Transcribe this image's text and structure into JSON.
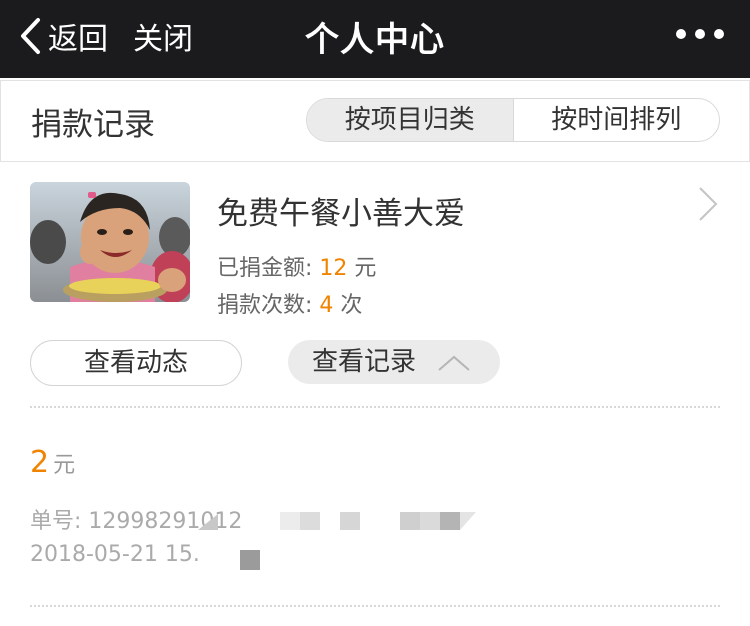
{
  "topbar": {
    "back_label": "返回",
    "close_label": "关闭",
    "title": "个人中心",
    "more_icon": "more-dots-icon"
  },
  "subbar": {
    "title": "捐款记录",
    "segments": [
      {
        "label": "按项目归类",
        "active": true
      },
      {
        "label": "按时间排列",
        "active": false
      }
    ]
  },
  "project": {
    "name": "免费午餐小善大爱",
    "donated_label": "已捐金额: ",
    "donated_value": "12",
    "donated_unit": " 元",
    "count_label": "捐款次数: ",
    "count_value": "4",
    "count_unit": " 次",
    "view_updates_label": "查看动态",
    "view_records_label": "查看记录"
  },
  "record": {
    "amount_value": "2",
    "amount_unit": "元",
    "order_text": "单号: 12998291012",
    "date_text": "2018-05-21 15."
  },
  "colors": {
    "accent": "#f08300",
    "topbar": "#1b1b1d"
  }
}
